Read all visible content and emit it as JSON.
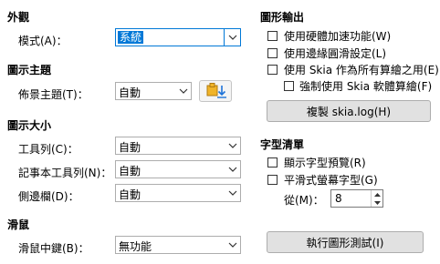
{
  "appearance": {
    "heading": "外觀",
    "style_label": "模式(A)：",
    "style_value": "系統"
  },
  "icon_theme": {
    "heading": "圖示主題",
    "label": "佈景主題(T)：",
    "value": "自動"
  },
  "icon_size": {
    "heading": "圖示大小",
    "toolbar_label": "工具列(C)：",
    "toolbar_value": "自動",
    "notebookbar_label": "記事本工具列(N)：",
    "notebookbar_value": "自動",
    "sidebar_label": "側邊欄(D)：",
    "sidebar_value": "自動"
  },
  "mouse": {
    "heading": "滑鼠",
    "middle_label": "滑鼠中鍵(B)：",
    "middle_value": "無功能"
  },
  "graphics": {
    "heading": "圖形輸出",
    "hw_accel": "使用硬體加速功能(W)",
    "antialias": "使用邊緣圓滑設定(L)",
    "skia": "使用 Skia 作為所有算繪之用(E)",
    "skia_software": "強制使用 Skia 軟體算繪(F)",
    "copy_log": "複製 skia.log(H)"
  },
  "font_lists": {
    "heading": "字型清單",
    "preview": "顯示字型預覽(R)",
    "smooth": "平滑式螢幕字型(G)",
    "from_label": "從(M)：",
    "from_value": "8"
  },
  "run_test": "執行圖形測試(I)"
}
